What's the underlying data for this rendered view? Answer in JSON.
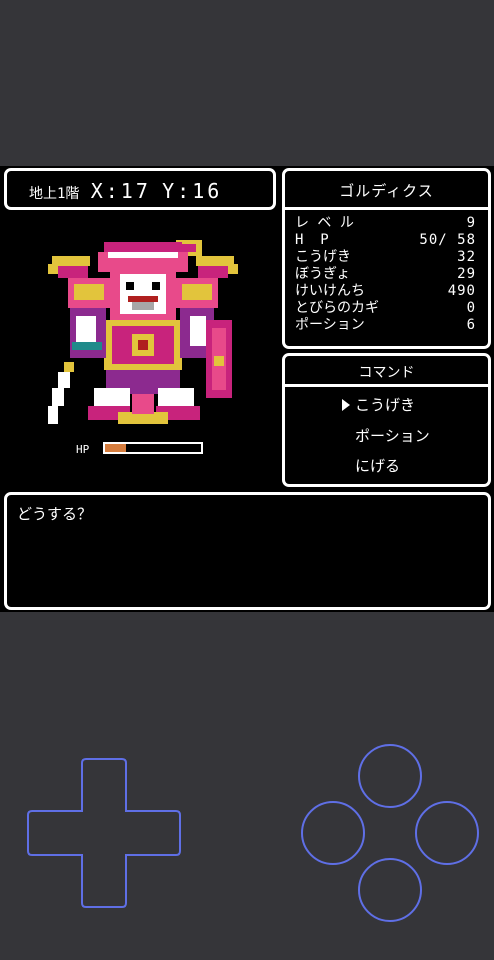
{
  "location": {
    "floor": "地上1階",
    "x_label": "X:",
    "x": "17",
    "y_label": "Y:",
    "y": "16"
  },
  "status": {
    "name": "ゴルディクス",
    "rows": [
      {
        "label": "レ ベ ル",
        "value": "9"
      },
      {
        "label": "H  P",
        "value": "50/ 58"
      },
      {
        "label": "こうげき",
        "value": "32"
      },
      {
        "label": "ぼうぎょ",
        "value": "29"
      },
      {
        "label": "けいけんち",
        "value": "490"
      },
      {
        "label": "とびらのカギ",
        "value": "0"
      },
      {
        "label": "ポーション",
        "value": "6"
      }
    ]
  },
  "command": {
    "title": "コマンド",
    "items": [
      "こうげき",
      "ポーション",
      "にげる"
    ],
    "selected_index": 0
  },
  "enemy": {
    "hp_label": "HP",
    "hp_fraction": 0.22
  },
  "message": {
    "text": "どうする？"
  },
  "controls": {
    "dpad_icon": "dpad-icon",
    "buttons": [
      "top-button",
      "left-button",
      "right-button",
      "bottom-button"
    ],
    "accent_color": "#5f6fe6"
  },
  "colors": {
    "background": "#353539",
    "screen": "#000000",
    "hp_fill": "#d67d3e"
  }
}
